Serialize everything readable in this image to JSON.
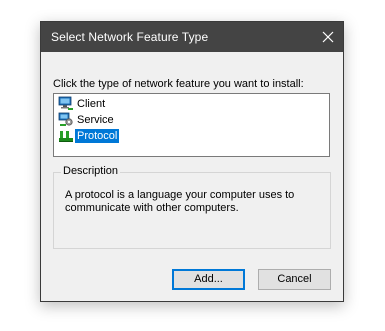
{
  "dialog": {
    "title": "Select Network Feature Type",
    "instruction": "Click the type of network feature you want to install:",
    "features": [
      {
        "label": "Client",
        "icon": "client-icon",
        "selected": false
      },
      {
        "label": "Service",
        "icon": "service-icon",
        "selected": false
      },
      {
        "label": "Protocol",
        "icon": "protocol-icon",
        "selected": true
      }
    ],
    "description": {
      "title": "Description",
      "text": "A protocol is a language your computer uses to communicate with other computers."
    },
    "buttons": {
      "add_label": "Add...",
      "cancel_label": "Cancel"
    }
  },
  "colors": {
    "titlebar": "#444444",
    "selection": "#0078d7",
    "dialog_bg": "#f0f0f0"
  }
}
